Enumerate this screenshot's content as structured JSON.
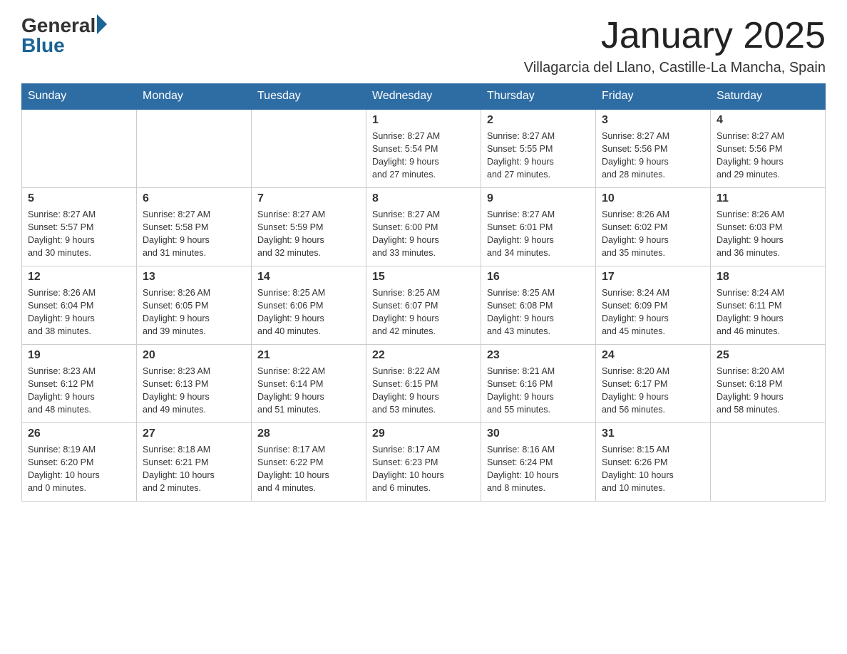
{
  "header": {
    "logo_general": "General",
    "logo_blue": "Blue",
    "month": "January 2025",
    "location": "Villagarcia del Llano, Castille-La Mancha, Spain"
  },
  "days_of_week": [
    "Sunday",
    "Monday",
    "Tuesday",
    "Wednesday",
    "Thursday",
    "Friday",
    "Saturday"
  ],
  "weeks": [
    [
      {
        "day": "",
        "info": ""
      },
      {
        "day": "",
        "info": ""
      },
      {
        "day": "",
        "info": ""
      },
      {
        "day": "1",
        "info": "Sunrise: 8:27 AM\nSunset: 5:54 PM\nDaylight: 9 hours\nand 27 minutes."
      },
      {
        "day": "2",
        "info": "Sunrise: 8:27 AM\nSunset: 5:55 PM\nDaylight: 9 hours\nand 27 minutes."
      },
      {
        "day": "3",
        "info": "Sunrise: 8:27 AM\nSunset: 5:56 PM\nDaylight: 9 hours\nand 28 minutes."
      },
      {
        "day": "4",
        "info": "Sunrise: 8:27 AM\nSunset: 5:56 PM\nDaylight: 9 hours\nand 29 minutes."
      }
    ],
    [
      {
        "day": "5",
        "info": "Sunrise: 8:27 AM\nSunset: 5:57 PM\nDaylight: 9 hours\nand 30 minutes."
      },
      {
        "day": "6",
        "info": "Sunrise: 8:27 AM\nSunset: 5:58 PM\nDaylight: 9 hours\nand 31 minutes."
      },
      {
        "day": "7",
        "info": "Sunrise: 8:27 AM\nSunset: 5:59 PM\nDaylight: 9 hours\nand 32 minutes."
      },
      {
        "day": "8",
        "info": "Sunrise: 8:27 AM\nSunset: 6:00 PM\nDaylight: 9 hours\nand 33 minutes."
      },
      {
        "day": "9",
        "info": "Sunrise: 8:27 AM\nSunset: 6:01 PM\nDaylight: 9 hours\nand 34 minutes."
      },
      {
        "day": "10",
        "info": "Sunrise: 8:26 AM\nSunset: 6:02 PM\nDaylight: 9 hours\nand 35 minutes."
      },
      {
        "day": "11",
        "info": "Sunrise: 8:26 AM\nSunset: 6:03 PM\nDaylight: 9 hours\nand 36 minutes."
      }
    ],
    [
      {
        "day": "12",
        "info": "Sunrise: 8:26 AM\nSunset: 6:04 PM\nDaylight: 9 hours\nand 38 minutes."
      },
      {
        "day": "13",
        "info": "Sunrise: 8:26 AM\nSunset: 6:05 PM\nDaylight: 9 hours\nand 39 minutes."
      },
      {
        "day": "14",
        "info": "Sunrise: 8:25 AM\nSunset: 6:06 PM\nDaylight: 9 hours\nand 40 minutes."
      },
      {
        "day": "15",
        "info": "Sunrise: 8:25 AM\nSunset: 6:07 PM\nDaylight: 9 hours\nand 42 minutes."
      },
      {
        "day": "16",
        "info": "Sunrise: 8:25 AM\nSunset: 6:08 PM\nDaylight: 9 hours\nand 43 minutes."
      },
      {
        "day": "17",
        "info": "Sunrise: 8:24 AM\nSunset: 6:09 PM\nDaylight: 9 hours\nand 45 minutes."
      },
      {
        "day": "18",
        "info": "Sunrise: 8:24 AM\nSunset: 6:11 PM\nDaylight: 9 hours\nand 46 minutes."
      }
    ],
    [
      {
        "day": "19",
        "info": "Sunrise: 8:23 AM\nSunset: 6:12 PM\nDaylight: 9 hours\nand 48 minutes."
      },
      {
        "day": "20",
        "info": "Sunrise: 8:23 AM\nSunset: 6:13 PM\nDaylight: 9 hours\nand 49 minutes."
      },
      {
        "day": "21",
        "info": "Sunrise: 8:22 AM\nSunset: 6:14 PM\nDaylight: 9 hours\nand 51 minutes."
      },
      {
        "day": "22",
        "info": "Sunrise: 8:22 AM\nSunset: 6:15 PM\nDaylight: 9 hours\nand 53 minutes."
      },
      {
        "day": "23",
        "info": "Sunrise: 8:21 AM\nSunset: 6:16 PM\nDaylight: 9 hours\nand 55 minutes."
      },
      {
        "day": "24",
        "info": "Sunrise: 8:20 AM\nSunset: 6:17 PM\nDaylight: 9 hours\nand 56 minutes."
      },
      {
        "day": "25",
        "info": "Sunrise: 8:20 AM\nSunset: 6:18 PM\nDaylight: 9 hours\nand 58 minutes."
      }
    ],
    [
      {
        "day": "26",
        "info": "Sunrise: 8:19 AM\nSunset: 6:20 PM\nDaylight: 10 hours\nand 0 minutes."
      },
      {
        "day": "27",
        "info": "Sunrise: 8:18 AM\nSunset: 6:21 PM\nDaylight: 10 hours\nand 2 minutes."
      },
      {
        "day": "28",
        "info": "Sunrise: 8:17 AM\nSunset: 6:22 PM\nDaylight: 10 hours\nand 4 minutes."
      },
      {
        "day": "29",
        "info": "Sunrise: 8:17 AM\nSunset: 6:23 PM\nDaylight: 10 hours\nand 6 minutes."
      },
      {
        "day": "30",
        "info": "Sunrise: 8:16 AM\nSunset: 6:24 PM\nDaylight: 10 hours\nand 8 minutes."
      },
      {
        "day": "31",
        "info": "Sunrise: 8:15 AM\nSunset: 6:26 PM\nDaylight: 10 hours\nand 10 minutes."
      },
      {
        "day": "",
        "info": ""
      }
    ]
  ]
}
